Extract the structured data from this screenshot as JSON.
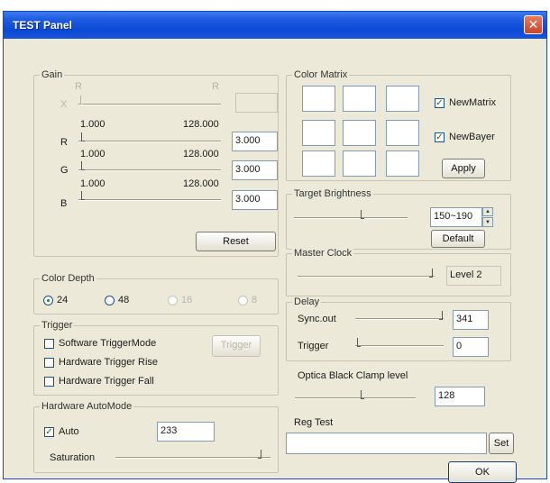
{
  "window": {
    "title": "TEST Panel",
    "close_glyph": "✕"
  },
  "gain": {
    "label": "Gain",
    "rows": [
      {
        "channel": "X",
        "min": "R",
        "max": "R",
        "value": "",
        "disabled": true
      },
      {
        "channel": "R",
        "min": "1.000",
        "max": "128.000",
        "value": "3.000",
        "disabled": false
      },
      {
        "channel": "G",
        "min": "1.000",
        "max": "128.000",
        "value": "3.000",
        "disabled": false
      },
      {
        "channel": "B",
        "min": "1.000",
        "max": "128.000",
        "value": "3.000",
        "disabled": false
      }
    ],
    "reset_label": "Reset"
  },
  "color_depth": {
    "label": "Color Depth",
    "options": [
      {
        "label": "24",
        "selected": true,
        "disabled": false
      },
      {
        "label": "48",
        "selected": false,
        "disabled": false
      },
      {
        "label": "16",
        "selected": false,
        "disabled": true
      },
      {
        "label": "8",
        "selected": false,
        "disabled": true
      }
    ]
  },
  "trigger": {
    "label": "Trigger",
    "options": [
      {
        "label": "Software TriggerMode",
        "checked": false
      },
      {
        "label": "Hardware Trigger Rise",
        "checked": false
      },
      {
        "label": "Hardware Trigger Fall",
        "checked": false
      }
    ],
    "trigger_button": "Trigger"
  },
  "hw_auto": {
    "label": "Hardware AutoMode",
    "auto_label": "Auto",
    "auto_checked": true,
    "auto_value": "233",
    "saturation_label": "Saturation"
  },
  "color_matrix": {
    "label": "Color Matrix",
    "cells": [
      "",
      "",
      "",
      "",
      "",
      "",
      "",
      "",
      ""
    ],
    "new_matrix_label": "NewMatrix",
    "new_bayer_label": "NewBayer",
    "apply_label": "Apply"
  },
  "target_brightness": {
    "label": "Target Brightness",
    "value": "150~190",
    "default_label": "Default"
  },
  "master_clock": {
    "label": "Master Clock",
    "value": "Level 2"
  },
  "delay": {
    "label": "Delay",
    "syncout_label": "Sync.out",
    "syncout_value": "341",
    "trigger_label": "Trigger",
    "trigger_value": "0"
  },
  "optical_black": {
    "label": "Optica Black Clamp level",
    "value": "128"
  },
  "reg_test": {
    "label": "Reg Test",
    "value": "",
    "set_label": "Set"
  },
  "ok_label": "OK",
  "colors": {
    "title_bar": "#0b49d6",
    "dialog_bg": "#ece9d8",
    "close": "#c9452a"
  },
  "icons": {
    "check": "✓",
    "spin_up": "▲",
    "spin_down": "▼"
  }
}
